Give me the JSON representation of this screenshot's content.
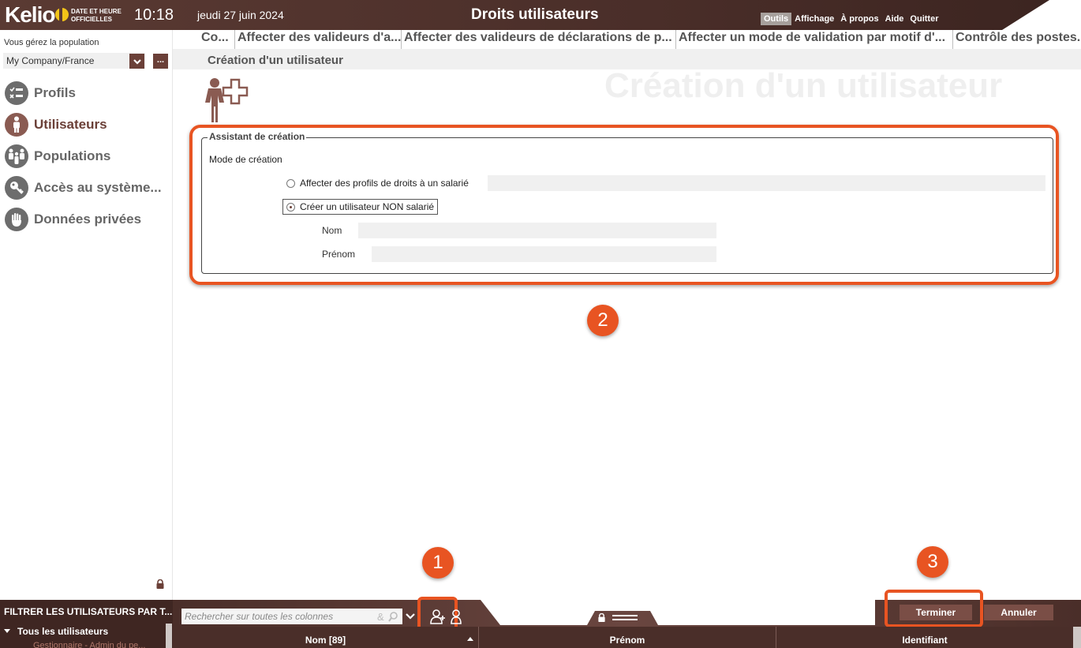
{
  "header": {
    "logo": "Kelio",
    "datetime_label_line1": "DATE ET HEURE",
    "datetime_label_line2": "OFFICIELLES",
    "time": "10:18",
    "date": "jeudi 27 juin 2024",
    "app_title": "Droits utilisateurs",
    "menu": [
      "Outils",
      "Affichage",
      "À propos",
      "Aide",
      "Quitter"
    ]
  },
  "sidebar": {
    "population_label": "Vous gérez la population",
    "population_value": "My Company/France",
    "more_label": "...",
    "items": [
      {
        "label": "Profils",
        "icon": "checklist-icon"
      },
      {
        "label": "Utilisateurs",
        "icon": "user-icon"
      },
      {
        "label": "Populations",
        "icon": "group-icon"
      },
      {
        "label": "Accès au système...",
        "icon": "key-icon"
      },
      {
        "label": "Données privées",
        "icon": "hand-icon"
      }
    ]
  },
  "tabs": [
    "Co...",
    "Affecter des valideurs d'a...",
    "Affecter des valideurs de déclarations de p...",
    "Affecter un mode de validation par motif d'...",
    "Contrôle des postes..."
  ],
  "content": {
    "subtitle": "Création d'un utilisateur",
    "watermark": "Création d'un utilisateur",
    "legend": "Assistant de création",
    "mode_label": "Mode de création",
    "option1": "Affecter des profils de droits à un salarié",
    "option2": "Créer un utilisateur NON salarié",
    "nom_label": "Nom",
    "prenom_label": "Prénom"
  },
  "badges": {
    "one": "1",
    "two": "2",
    "three": "3"
  },
  "bottom": {
    "filter_title": "FILTRER LES UTILISATEURS PAR T...",
    "tree_all": "Tous les utilisateurs",
    "tree_sub": "Gestionnaire - Admin du pe...",
    "search_placeholder": "Rechercher sur toutes les colonnes",
    "terminer": "Terminer",
    "annuler": "Annuler",
    "columns": [
      "Nom [89]",
      "Prénom",
      "Identifiant"
    ]
  },
  "colors": {
    "brand": "#5a3a33",
    "accent": "#e85422",
    "logo_dot": "#f2c418"
  }
}
